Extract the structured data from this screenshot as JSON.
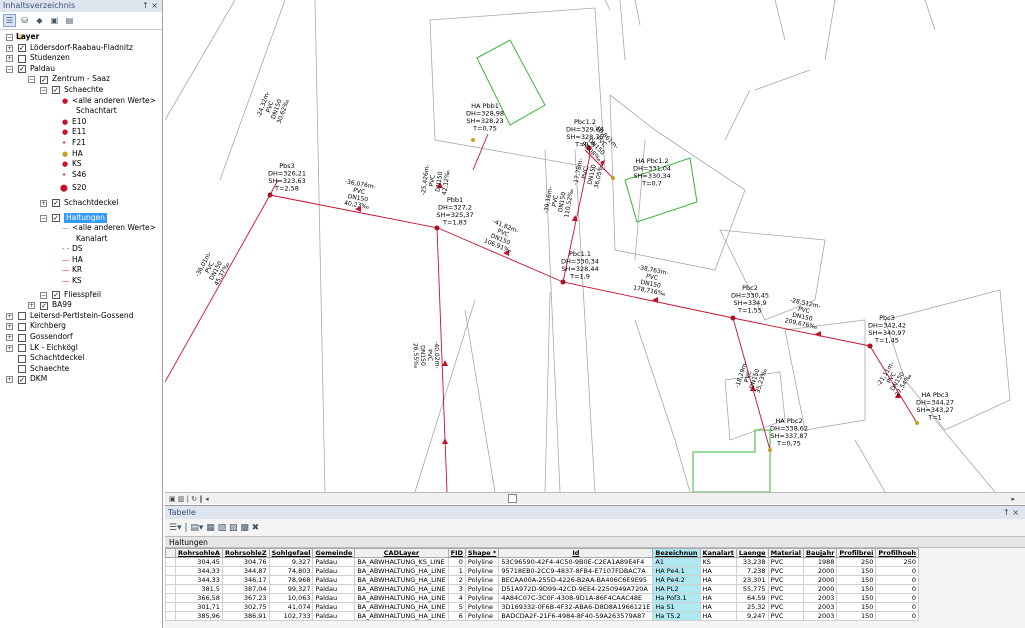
{
  "toc": {
    "title": "Inhaltsverzeichnis",
    "controls": "↑ ×",
    "items": [
      {
        "label": "Layer",
        "expander": "−"
      },
      {
        "label": "Lödersdorf-Raabau-Fladnitz",
        "expander": "+",
        "checked": "✓"
      },
      {
        "label": "Studenzen",
        "expander": "+",
        "checked": ""
      },
      {
        "label": "Paldau",
        "expander": "−",
        "checked": "✓"
      },
      {
        "label": "Zentrum - Saaz",
        "expander": "−",
        "checked": "✓"
      },
      {
        "label": "Schaechte",
        "expander": "−",
        "checked": "✓"
      },
      {
        "label": "<alle anderen Werte>"
      },
      {
        "label": "Schachtart"
      },
      {
        "label": "E10"
      },
      {
        "label": "E11"
      },
      {
        "label": "F21"
      },
      {
        "label": "HA"
      },
      {
        "label": "KS"
      },
      {
        "label": "S46"
      },
      {
        "label": "S20"
      },
      {
        "label": "Schachtdeckel",
        "expander": "+",
        "checked": "✓"
      },
      {
        "label": "Haltungen",
        "expander": "−",
        "checked": "✓"
      },
      {
        "label": "<alle anderen Werte>"
      },
      {
        "label": "Kanalart"
      },
      {
        "label": "DS"
      },
      {
        "label": "HA"
      },
      {
        "label": "KR"
      },
      {
        "label": "KS"
      },
      {
        "label": "Fliesspfeil",
        "expander": "−",
        "checked": "✓"
      },
      {
        "label": "BA99",
        "expander": "+",
        "checked": "✓"
      },
      {
        "label": "Leitersd-Pertlstein-Gossend",
        "expander": "+",
        "checked": ""
      },
      {
        "label": "Kirchberg",
        "expander": "+",
        "checked": ""
      },
      {
        "label": "Gossendorf",
        "expander": "+",
        "checked": ""
      },
      {
        "label": "LK - Eichkögl",
        "expander": "+",
        "checked": ""
      },
      {
        "label": "Schachtdeckel",
        "expander": "",
        "checked": ""
      },
      {
        "label": "Schaechte",
        "expander": "",
        "checked": ""
      },
      {
        "label": "DKM",
        "expander": "+",
        "checked": "✓"
      }
    ]
  },
  "map": {
    "shafts": [
      {
        "lines": [
          "Pbs3",
          "DH=326,21",
          "SH=323,63",
          "T=2,58"
        ]
      },
      {
        "lines": [
          "Pbb1",
          "DH=327,2",
          "SH=325,37",
          "T=1,83"
        ]
      },
      {
        "lines": [
          "Pbc1.1",
          "DH=330,34",
          "SH=328,44",
          "T=1,9"
        ]
      },
      {
        "lines": [
          "Pbc2",
          "DH=330,45",
          "SH=334,9",
          "T=1,55"
        ]
      },
      {
        "lines": [
          "Pbc3",
          "DH=342,42",
          "SH=340,97",
          "T=1,45"
        ]
      },
      {
        "lines": [
          "HA Pbb1",
          "DH=328,98",
          "SH=328,23",
          "T=0,75"
        ]
      },
      {
        "lines": [
          "Pbc1.2",
          "DH=329,66",
          "SH=328,75",
          "T=0,9"
        ]
      },
      {
        "lines": [
          "HA Pbc1.2",
          "DH=331,04",
          "SH=330,34",
          "T=0,7"
        ]
      },
      {
        "lines": [
          "HA Pbc2",
          "DH=338,62",
          "SH=337,87",
          "T=0,75"
        ]
      },
      {
        "lines": [
          "HA Pbc3",
          "DH=344,27",
          "SH=343,27",
          "T=1"
        ]
      }
    ],
    "pipes": [
      {
        "lines": [
          "-36,076m-",
          "PVC",
          "DN150",
          "40,23‰"
        ]
      },
      {
        "lines": [
          "-41,82m-",
          "PVC",
          "DN150",
          "106,91‰"
        ]
      },
      {
        "lines": [
          "-38,763m-",
          "PVC",
          "DN150",
          "178,716‰"
        ]
      },
      {
        "lines": [
          "-28,512m-",
          "PVC",
          "DN150",
          "209,676‰"
        ]
      },
      {
        "lines": [
          "-10,861m-",
          "PVC",
          "DN150",
          "90,08‰"
        ]
      },
      {
        "lines": [
          "-25,426m-",
          "PVC",
          "DN150",
          "42,12‰"
        ]
      },
      {
        "lines": [
          "-39,16m-",
          "PVC",
          "DN150",
          "110,52‰"
        ]
      },
      {
        "lines": [
          "-24,32m-",
          "PVC",
          "DN150",
          "30,62‰"
        ]
      },
      {
        "lines": [
          "-36,01m-",
          "PVC",
          "DN150",
          "45,37‰"
        ]
      },
      {
        "lines": [
          "-40,02m-",
          "PVC",
          "DN150",
          "26,55‰"
        ]
      },
      {
        "lines": [
          "-18,29m-",
          "PVC",
          "DN150",
          "35,23‰"
        ]
      },
      {
        "lines": [
          "-21,11m-",
          "PVC",
          "DN150",
          "27,54‰"
        ]
      },
      {
        "lines": [
          "-17,78m-",
          "PVC",
          "DN150",
          "36,05‰"
        ]
      }
    ]
  },
  "scrollbar": {
    "left_tools": "▣ ▥ | ↻ ‖ ◂",
    "right": "▸"
  },
  "table": {
    "panel_title": "Tabelle",
    "controls": "↑ ×",
    "toolbar": "☰▾ | ▤▾ ▦ ▧ ▨ ▩ ✖",
    "tab": "Haltungen",
    "columns": [
      "RohrsohleA",
      "RohrsohleZ",
      "Sohlgefael",
      "Gemeinde",
      "CADLayer",
      "FID",
      "Shape *",
      "Id",
      "Bezeichnun",
      "Kanalart",
      "Laenge",
      "Material",
      "Baujahr",
      "Profilbrei",
      "Profilhoeh"
    ],
    "rows": [
      [
        "304,45",
        "304,76",
        "9,327",
        "Paldau",
        "BA_ABWHALTUNG_KS_LINE",
        "0",
        "Polyline",
        "53C96590-42F4-4C50-9B0E-C2EA1A89E4F4",
        "A1",
        "KS",
        "33,238",
        "PVC",
        "1988",
        "250",
        "250"
      ],
      [
        "344,33",
        "344,87",
        "74,803",
        "Paldau",
        "BA_ABWHALTUNG_HA_LINE",
        "1",
        "Polyline",
        "95718EB0-2CC9-4837-8FB4-E7107FDBAC7A",
        "HA Pe4.1",
        "HA",
        "7,238",
        "PVC",
        "2000",
        "150",
        "0"
      ],
      [
        "344,33",
        "346,17",
        "78,968",
        "Paldau",
        "BA_ABWHALTUNG_HA_LINE",
        "2",
        "Polyline",
        "BECAA00A-255D-4226-B2AA-BA406C6E9E95",
        "HA Pe4.2",
        "HA",
        "23,301",
        "PVC",
        "2000",
        "150",
        "0"
      ],
      [
        "381,5",
        "387,04",
        "99,327",
        "Paldau",
        "BA_ABWHALTUNG_HA_LINE",
        "3",
        "Polyline",
        "D51A972D-9D99-42CD-9EE4-2250949A720A",
        "HA PL2",
        "HA",
        "55,775",
        "PVC",
        "2000",
        "150",
        "0"
      ],
      [
        "366,58",
        "367,23",
        "10,063",
        "Paldau",
        "BA_ABWHALTUNG_HA_LINE",
        "4",
        "Polyline",
        "4A84C07C-3C0F-4308-9D1A-86F4CAAC48E",
        "Ha Pof3.1",
        "HA",
        "64,59",
        "PVC",
        "2003",
        "150",
        "0"
      ],
      [
        "301,71",
        "302,75",
        "41,074",
        "Paldau",
        "BA_ABWHALTUNG_HA_LINE",
        "5",
        "Polyline",
        "3D169332-0F6B-4F32-ABA6-D8D8A1966121E",
        "Ha S1",
        "HA",
        "25,32",
        "PVC",
        "2003",
        "150",
        "0"
      ],
      [
        "385,96",
        "386,91",
        "102,733",
        "Paldau",
        "BA_ABWHALTUNG_HA_LINE",
        "6",
        "Polyline",
        "BADCDA2F-21F6-4984-8F40-59A263579A87",
        "Ha T5.2",
        "HA",
        "9,247",
        "PVC",
        "2003",
        "150",
        "0"
      ]
    ]
  }
}
